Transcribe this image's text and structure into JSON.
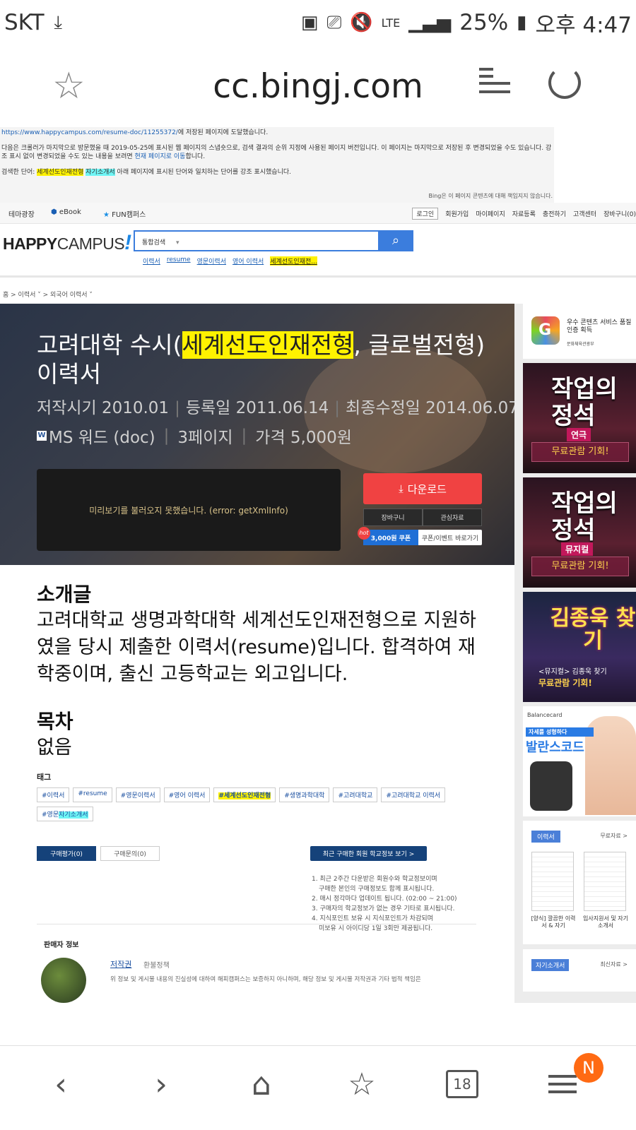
{
  "status_bar": {
    "carrier": "SKT",
    "battery": "25%",
    "time": "오후 4:47",
    "lte": "LTE"
  },
  "browser": {
    "url": "cc.bingj.com",
    "tabs_count": "18",
    "menu_badge": "N"
  },
  "bing_notice": {
    "source_url": "https://www.happycampus.com/resume-doc/11255372/",
    "line1_suffix": "에 저장된 페이지에 도달했습니다.",
    "line2": "다음은 크롤러가 마지막으로 방문했을 때 2019-05-25에 표시된 웹 페이지의 스냅숏으로, 검색 결과의 순위 지정에 사용된 페이지 버전입니다. 이 페이지는 마지막으로 저장된 후 변경되었을 수도 있습니다. 강",
    "line3_prefix": "조 표시 없이 변경되었을 수도 있는 내용을 보려면 ",
    "line3_link": "현재 페이지로 이동",
    "line3_suffix": "합니다.",
    "line4_prefix": "검색한 단어: ",
    "term1": "세계선도인재전형",
    "term2": "자기소개서",
    "line4_suffix": " 아래 페이지에 표시된 단어와 일치하는 단어를 강조 표시했습니다.",
    "disclaimer": "Bing은 이 페이지 콘텐츠에 대해 책임지지 않습니다."
  },
  "topnav": {
    "items": [
      "테마광장",
      "eBook",
      "FUN캠퍼스"
    ],
    "login": "로그인",
    "right_items": [
      "회원가입",
      "마이페이지",
      "자료등록",
      "충전하기",
      "고객센터",
      "장바구니(0)"
    ]
  },
  "header": {
    "logo_bold": "HAPPY",
    "logo_thin": "CAMPUS",
    "search_select": "통합검색",
    "keywords": [
      "이력서",
      "resume",
      "영문이력서",
      "영어 이력서"
    ],
    "keyword_highlight": "세계선도인재전..."
  },
  "breadcrumb": "홈 > 이력서 ˅ > 외국어 이력서 ˅",
  "hero": {
    "title_prefix": "고려대학 수시(",
    "title_highlight": "세계선도인재전형",
    "title_suffix": ", 글로벌전형) 이력서",
    "written": "저작시기 2010.01",
    "registered": "등록일 2011.06.14",
    "modified": "최종수정일 2014.06.07",
    "format": "MS 워드 (doc)",
    "pages": "3페이지",
    "price": "가격 5,000원",
    "preview_error": "미리보기를 불러오지 못했습니다. (error: getXmlInfo)",
    "download": "다운로드",
    "cart": "장바구니",
    "interest": "관심자료",
    "coupon_amount": "3,000원 쿠폰",
    "coupon_link": "쿠폰/이벤트 바로가기",
    "hot": "hot"
  },
  "intro": {
    "heading": "소개글",
    "body": "고려대학교 생명과학대학 세계선도인재전형으로 지원하였을 당시 제출한 이력서(resume)입니다. 합격하여 재학중이며, 출신 고등학교는 외고입니다."
  },
  "toc": {
    "heading": "목차",
    "body": "없음"
  },
  "tags": {
    "heading": "태그",
    "items": [
      "#이력서",
      "#resume",
      "#영문이력서",
      "#영어 이력서",
      "#세계선도인재전형",
      "#생명과학대학",
      "#고려대학교",
      "#고려대학교 이력서"
    ],
    "last_prefix": "#영문",
    "last_highlight": "자기소개서"
  },
  "review": {
    "tab_active": "구매평가(0)",
    "tab_inactive": "구매문의(0)",
    "recent_btn": "최근 구매한 회원 학교정보 보기 >",
    "notes": [
      "1. 최근 2주간 다운받은 회원수와 학교정보이며",
      "   구매한 본인의 구매정보도 함께 표시됩니다.",
      "2. 매시 정각마다 업데이트 됩니다. (02:00 ~ 21:00)",
      "3. 구매자의 학교정보가 없는 경우 기타로 표시됩니다.",
      "4. 지식포인트 보유 시 지식포인트가 차감되며",
      "   미보유 시 아이디당 1일 3회만 제공됩니다."
    ]
  },
  "seller": {
    "heading": "판매자 정보",
    "name": "저작권",
    "refund": "환불정책",
    "disclaimer": "위 정보 및 게시물 내용의 진실성에 대하여 해피캠퍼스는 보증하지 아니하며, 해당 정보 및 게시물 저작권과 기타 법적 책임은"
  },
  "sidebar": {
    "cert_title": "우수 콘텐츠 서비스 품질인증 획득",
    "cert_sub": "문화체육관광부",
    "ad1_title": "작업의 정석",
    "ad1_cat": "연극",
    "ad1_free": "무료관람 기회!",
    "ad2_title": "작업의 정석",
    "ad2_cat": "뮤지컬",
    "ad2_free": "무료관람 기회!",
    "ad3_title": "김종욱 찾기",
    "ad3_sub": "<뮤지컬> 김종욱 찾기",
    "ad3_free": "무료관람 기회!",
    "ad4_brand": "Balancecard",
    "ad4_slogan": "자세를 성형하다",
    "ad4_name": "발란스코드",
    "forms_badge": "이력서",
    "forms_more": "무료자료 >",
    "form1_caption": "[양식] 깔끔한 이력서 & 자기",
    "form2_caption": "입사지원서 및 자기소개서",
    "intro_badge": "자기소개서",
    "intro_more": "최신자료 >"
  }
}
